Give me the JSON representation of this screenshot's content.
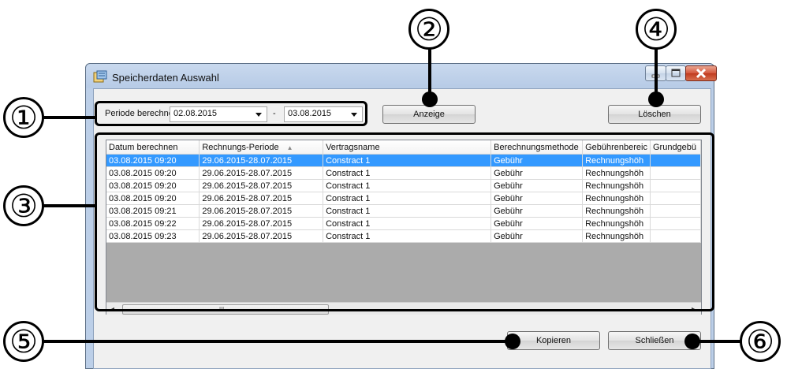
{
  "window": {
    "title": "Speicherdaten Auswahl",
    "controls": {
      "minimize": "–",
      "maximize": "□",
      "close": "✕"
    }
  },
  "toolbar": {
    "period_label": "Periode berechnen",
    "date_from": "02.08.2015",
    "separator": "-",
    "date_to": "03.08.2015",
    "show_button": "Anzeige",
    "delete_button": "Löschen"
  },
  "grid": {
    "columns": [
      "Datum berechnen",
      "Rechnungs-Periode",
      "Vertragsname",
      "Berechnungsmethode",
      "Gebührenbereic",
      "Grundgebü"
    ],
    "rows": [
      [
        "03.08.2015 09:20",
        "29.06.2015-28.07.2015",
        "Constract 1",
        "Gebühr",
        "Rechnungshöh",
        ""
      ],
      [
        "03.08.2015 09:20",
        "29.06.2015-28.07.2015",
        "Constract 1",
        "Gebühr",
        "Rechnungshöh",
        ""
      ],
      [
        "03.08.2015 09:20",
        "29.06.2015-28.07.2015",
        "Constract 1",
        "Gebühr",
        "Rechnungshöh",
        ""
      ],
      [
        "03.08.2015 09:20",
        "29.06.2015-28.07.2015",
        "Constract 1",
        "Gebühr",
        "Rechnungshöh",
        ""
      ],
      [
        "03.08.2015 09:21",
        "29.06.2015-28.07.2015",
        "Constract 1",
        "Gebühr",
        "Rechnungshöh",
        ""
      ],
      [
        "03.08.2015 09:22",
        "29.06.2015-28.07.2015",
        "Constract 1",
        "Gebühr",
        "Rechnungshöh",
        ""
      ],
      [
        "03.08.2015 09:23",
        "29.06.2015-28.07.2015",
        "Constract 1",
        "Gebühr",
        "Rechnungshöh",
        ""
      ]
    ],
    "selected_row": 0,
    "scrollbar": {
      "left": "◂",
      "right": "▸",
      "grip": "III"
    }
  },
  "footer": {
    "copy_button": "Kopieren",
    "close_button": "Schließen"
  },
  "callouts": [
    "①",
    "②",
    "③",
    "④",
    "⑤",
    "⑥"
  ],
  "colors": {
    "selection": "#3399ff",
    "title_bar": "#bccfe8",
    "close_button": "#c03b1f"
  }
}
